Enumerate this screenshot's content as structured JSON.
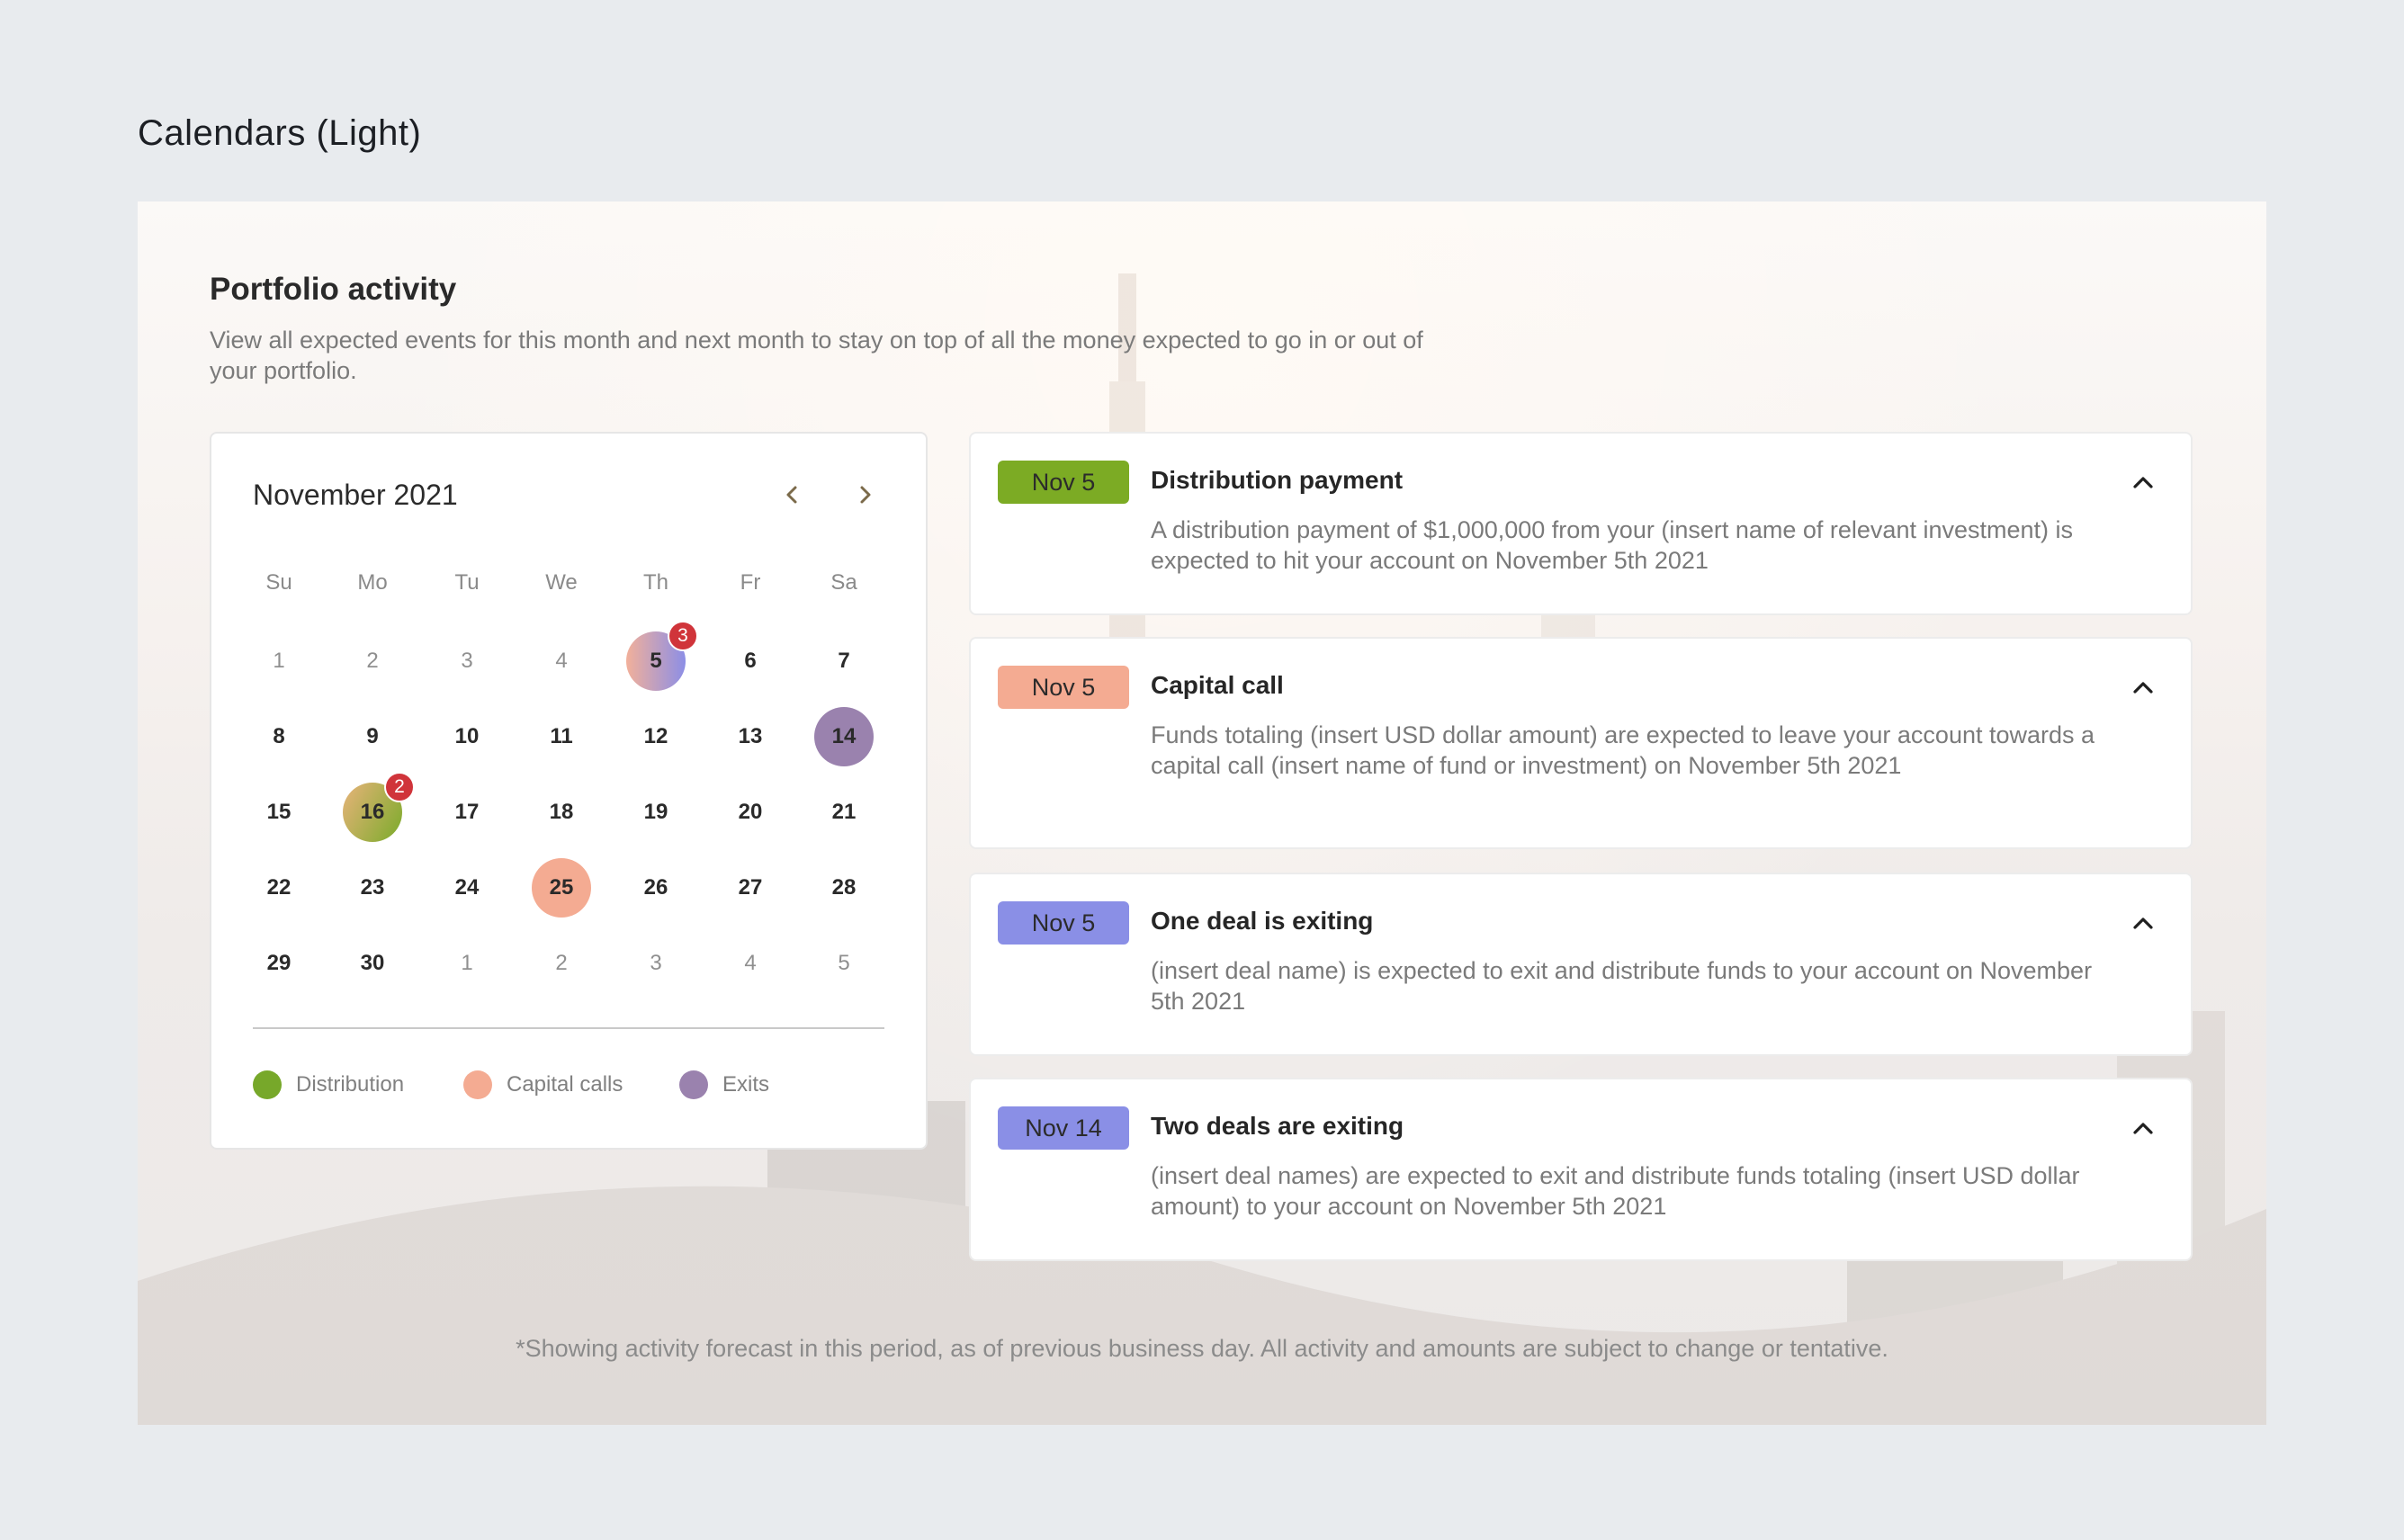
{
  "page": {
    "title": "Calendars (Light)"
  },
  "panel": {
    "title": "Portfolio activity",
    "description": "View all expected events for this month and next month to stay on top of all the money expected to go in or out of your portfolio.",
    "footnote": "*Showing activity forecast in this period, as of previous business day. All activity and amounts are subject to change or tentative."
  },
  "calendar": {
    "month_label": "November 2021",
    "prev_icon": "chevron-left-icon",
    "next_icon": "chevron-right-icon",
    "weekdays": [
      "Su",
      "Mo",
      "Tu",
      "We",
      "Th",
      "Fr",
      "Sa"
    ],
    "weeks": [
      [
        {
          "d": "1",
          "muted": true
        },
        {
          "d": "2",
          "muted": true
        },
        {
          "d": "3",
          "muted": true
        },
        {
          "d": "4",
          "muted": true
        },
        {
          "d": "5",
          "event": "d5",
          "badge": "3"
        },
        {
          "d": "6"
        },
        {
          "d": "7"
        }
      ],
      [
        {
          "d": "8"
        },
        {
          "d": "9"
        },
        {
          "d": "10"
        },
        {
          "d": "11"
        },
        {
          "d": "12"
        },
        {
          "d": "13"
        },
        {
          "d": "14",
          "event": "d14"
        }
      ],
      [
        {
          "d": "15"
        },
        {
          "d": "16",
          "event": "d16",
          "badge": "2"
        },
        {
          "d": "17"
        },
        {
          "d": "18"
        },
        {
          "d": "19"
        },
        {
          "d": "20"
        },
        {
          "d": "21"
        }
      ],
      [
        {
          "d": "22"
        },
        {
          "d": "23"
        },
        {
          "d": "24"
        },
        {
          "d": "25",
          "event": "d25"
        },
        {
          "d": "26"
        },
        {
          "d": "27"
        },
        {
          "d": "28"
        }
      ],
      [
        {
          "d": "29"
        },
        {
          "d": "30"
        },
        {
          "d": "1",
          "muted": true
        },
        {
          "d": "2",
          "muted": true
        },
        {
          "d": "3",
          "muted": true
        },
        {
          "d": "4",
          "muted": true
        },
        {
          "d": "5",
          "muted": true
        }
      ]
    ],
    "legend": [
      {
        "label": "Distribution",
        "color": "#77a82a"
      },
      {
        "label": "Capital calls",
        "color": "#f4ab92"
      },
      {
        "label": "Exits",
        "color": "#9a82ae"
      }
    ]
  },
  "events": [
    {
      "date": "Nov 5",
      "date_color": "#7cab24",
      "title": "Distribution payment",
      "body": "A distribution payment of $1,000,000 from your (insert name of relevant investment) is expected to hit your account on November 5th 2021"
    },
    {
      "date": "Nov 5",
      "date_color": "#f4ab92",
      "title": "Capital call",
      "body": "Funds totaling (insert USD dollar amount) are expected to leave your account towards a capital call (insert name of fund or investment) on November 5th 2021"
    },
    {
      "date": "Nov 5",
      "date_color": "#8a8fe6",
      "title": "One deal is exiting",
      "body": "(insert deal name) is expected to exit and distribute funds to your account on November 5th 2021"
    },
    {
      "date": "Nov 14",
      "date_color": "#8a8fe6",
      "title": "Two deals are exiting",
      "body": "(insert deal names) are expected to exit and distribute funds totaling (insert USD dollar amount) to your account on November 5th 2021"
    }
  ]
}
